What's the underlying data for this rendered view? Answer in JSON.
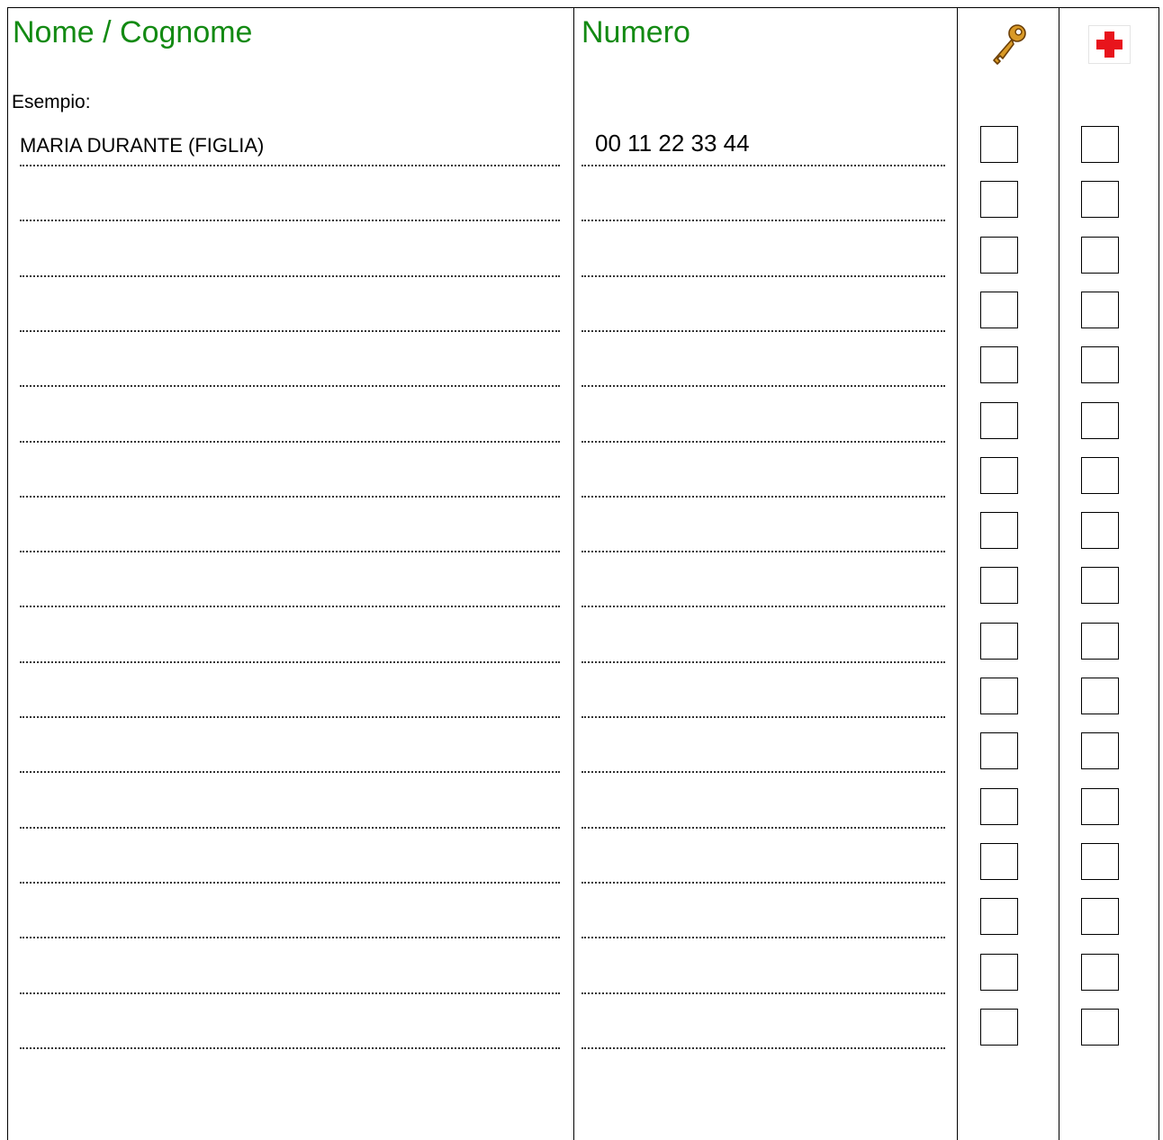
{
  "header": {
    "name_title": "Nome / Cognome",
    "number_title": "Numero"
  },
  "example": {
    "label": "Esempio:",
    "name": "MARIA DURANTE (FIGLIA)",
    "number": "00 11 22 33 44"
  },
  "rows": [
    {
      "name": "",
      "number": ""
    },
    {
      "name": "",
      "number": ""
    },
    {
      "name": "",
      "number": ""
    },
    {
      "name": "",
      "number": ""
    },
    {
      "name": "",
      "number": ""
    },
    {
      "name": "",
      "number": ""
    },
    {
      "name": "",
      "number": ""
    },
    {
      "name": "",
      "number": ""
    },
    {
      "name": "",
      "number": ""
    },
    {
      "name": "",
      "number": ""
    },
    {
      "name": "",
      "number": ""
    },
    {
      "name": "",
      "number": ""
    },
    {
      "name": "",
      "number": ""
    },
    {
      "name": "",
      "number": ""
    },
    {
      "name": "",
      "number": ""
    },
    {
      "name": "",
      "number": ""
    },
    {
      "name": "",
      "number": ""
    }
  ],
  "icons": {
    "key_column": "key-icon",
    "medical_column": "red-cross-icon"
  },
  "colors": {
    "title_green": "#138a13",
    "cross_red": "#e8141c",
    "key_gold": "#c8891a"
  }
}
